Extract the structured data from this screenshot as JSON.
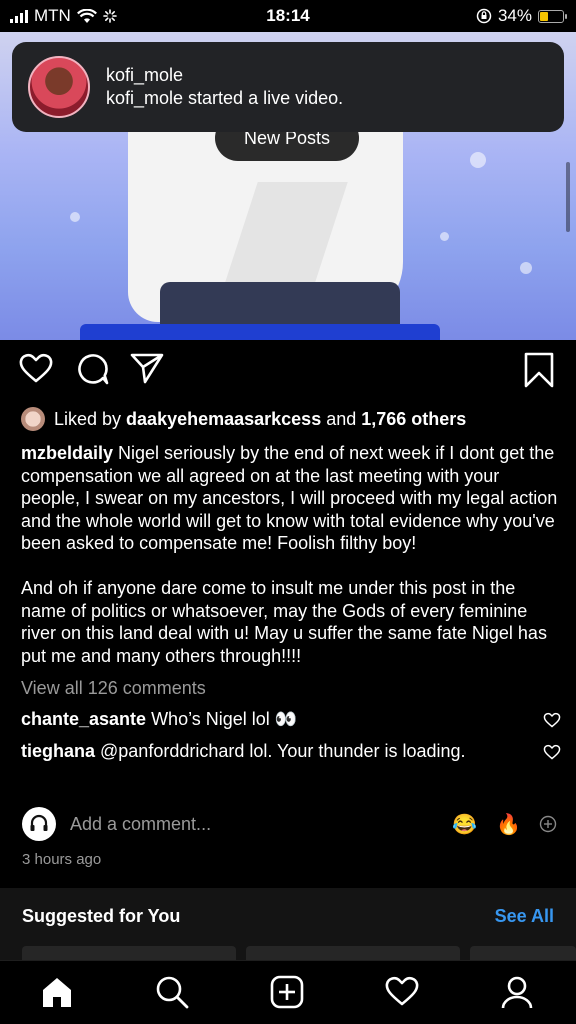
{
  "status_bar": {
    "carrier": "MTN",
    "time": "18:14",
    "battery": "34%",
    "battery_level": 0.34
  },
  "notification": {
    "title": "kofi_mole",
    "message": "kofi_mole started a live video."
  },
  "new_posts_pill": {
    "label": "New Posts"
  },
  "post": {
    "likes": {
      "prefix": "Liked by ",
      "user": "daakyehemaasarkcess",
      "middle": " and ",
      "others": "1,766 others"
    },
    "caption": {
      "username": "mzbeldaily",
      "text": " Nigel seriously by the end of next week if I dont get the compensation we all agreed on at the last meeting with your people, I swear on my ancestors, I will proceed with my legal action and the whole world will get to know with total evidence why you've been asked to compensate me! Foolish filthy boy!\n\nAnd oh if anyone dare come to insult me under this post in the name of politics or whatsoever, may the Gods of every feminine river on this land deal with u! May u suffer the same fate Nigel has put me and many others through!!!!"
    },
    "view_comments": "View all 126 comments",
    "comments": [
      {
        "user": "chante_asante",
        "text": " Who’s Nigel lol 👀"
      },
      {
        "user": "tieghana",
        "text": " @panforddrichard lol. Your thunder is loading."
      }
    ],
    "add_comment_placeholder": "Add a comment...",
    "quick_emojis": [
      "😂",
      "🔥"
    ],
    "timestamp": "3 hours ago"
  },
  "suggested": {
    "title": "Suggested for You",
    "see_all": "See All"
  },
  "colors": {
    "link": "#3897f0",
    "muted": "#9a9a9a",
    "battery": "#f5c400"
  }
}
